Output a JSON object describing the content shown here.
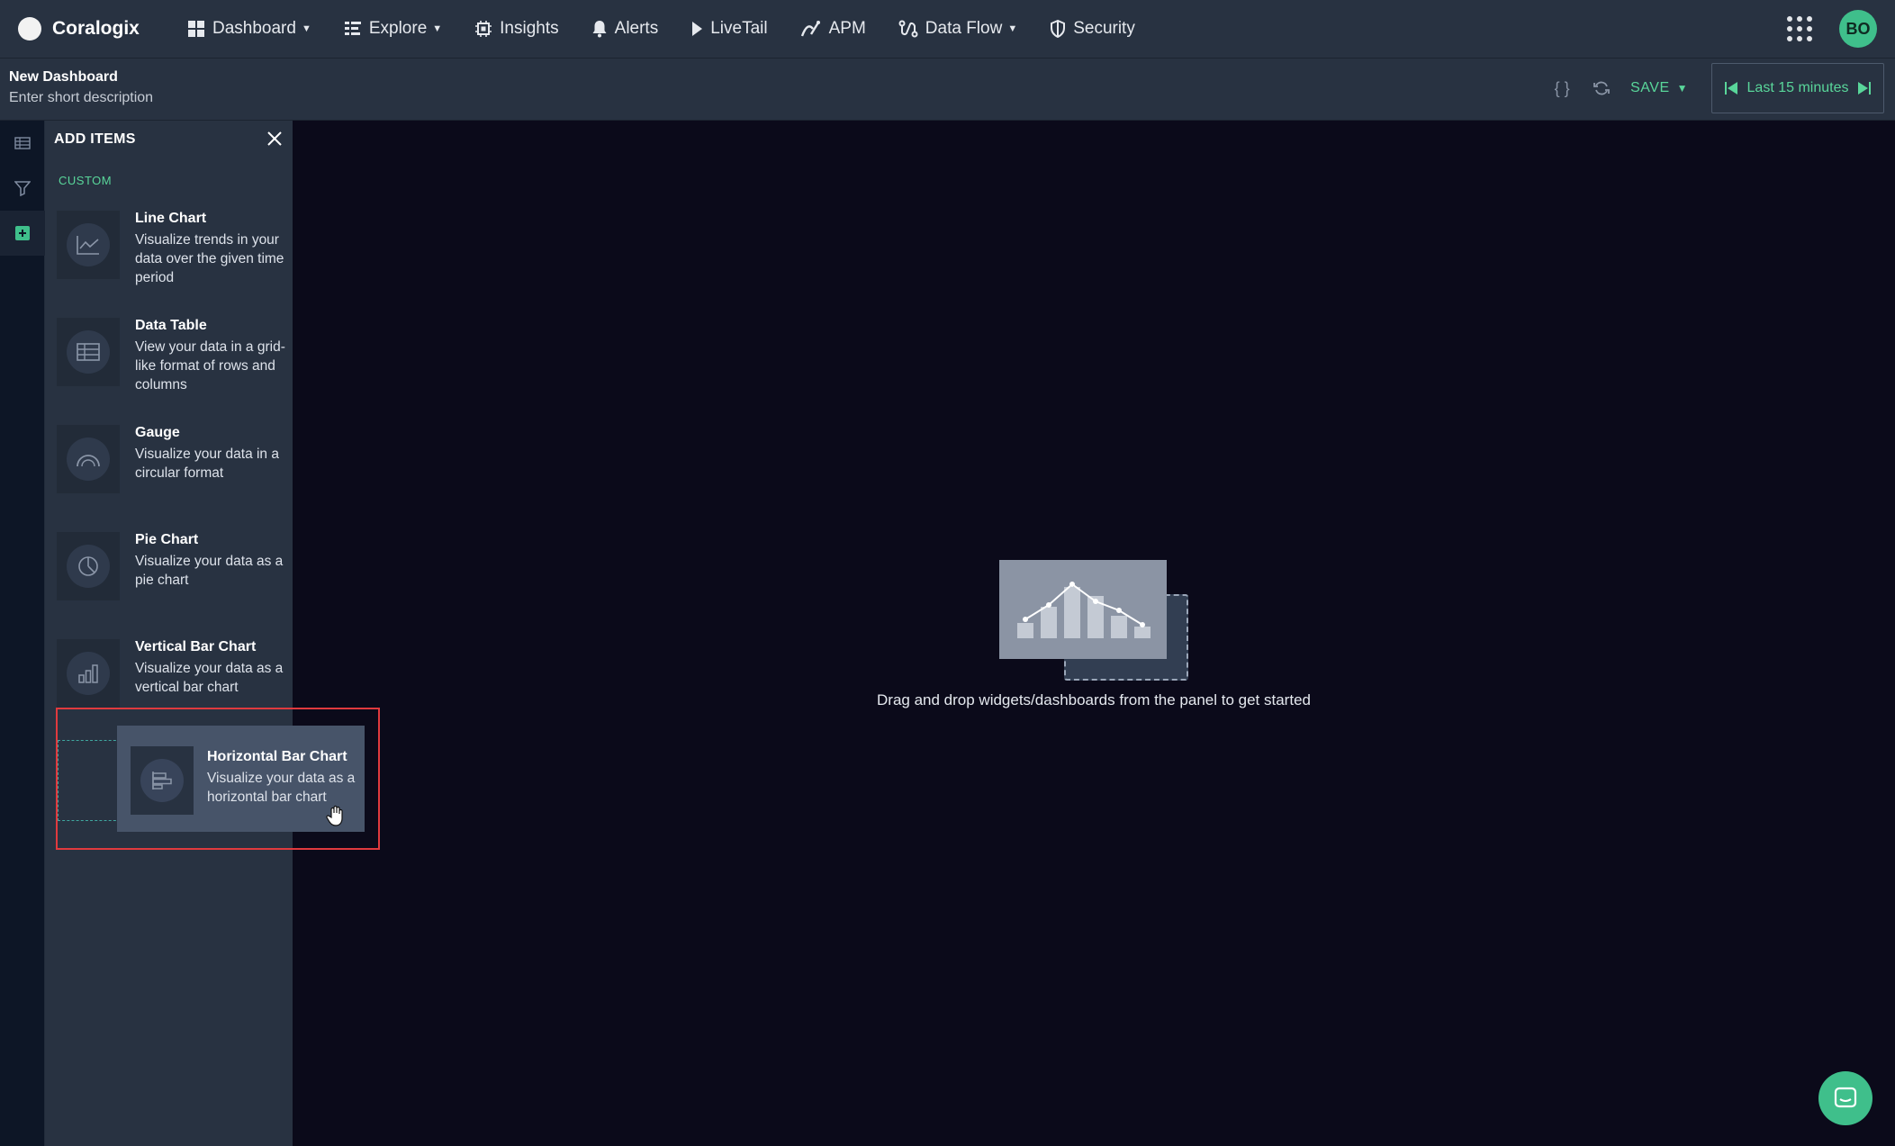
{
  "brand": {
    "name": "Coralogix"
  },
  "nav": {
    "items": [
      {
        "label": "Dashboard",
        "icon": "dashboard-icon",
        "caret": true
      },
      {
        "label": "Explore",
        "icon": "explore-icon",
        "caret": true
      },
      {
        "label": "Insights",
        "icon": "insights-icon",
        "caret": false
      },
      {
        "label": "Alerts",
        "icon": "bell-icon",
        "caret": false
      },
      {
        "label": "LiveTail",
        "icon": "play-icon",
        "caret": false
      },
      {
        "label": "APM",
        "icon": "apm-icon",
        "caret": false
      },
      {
        "label": "Data Flow",
        "icon": "data-flow-icon",
        "caret": true
      },
      {
        "label": "Security",
        "icon": "shield-icon",
        "caret": false
      }
    ],
    "avatar_initials": "BO"
  },
  "dashboard": {
    "title": "New Dashboard",
    "description": "Enter short description",
    "save_label": "SAVE",
    "time_range": "Last 15 minutes"
  },
  "panel": {
    "title": "ADD ITEMS",
    "section": "CUSTOM",
    "items": [
      {
        "title": "Line Chart",
        "description": "Visualize trends in your data over the given time period",
        "icon": "line-chart-icon"
      },
      {
        "title": "Data Table",
        "description": "View your data in a grid-like format of rows and columns",
        "icon": "table-icon"
      },
      {
        "title": "Gauge",
        "description": "Visualize your data in a circular format",
        "icon": "gauge-icon"
      },
      {
        "title": "Pie Chart",
        "description": "Visualize your data as a pie chart",
        "icon": "pie-chart-icon"
      },
      {
        "title": "Vertical Bar Chart",
        "description": "Visualize your data as a vertical bar chart",
        "icon": "vertical-bar-chart-icon"
      }
    ],
    "dragging": {
      "title": "Horizontal Bar Chart",
      "description": "Visualize your data as a horizontal bar chart",
      "icon": "horizontal-bar-chart-icon"
    }
  },
  "main": {
    "empty_text": "Drag and drop widgets/dashboards from the panel to get started"
  },
  "colors": {
    "accent": "#59d69a",
    "nav_bg": "#283241",
    "canvas_bg": "#0b0a1a",
    "highlight": "#e03a3e"
  }
}
